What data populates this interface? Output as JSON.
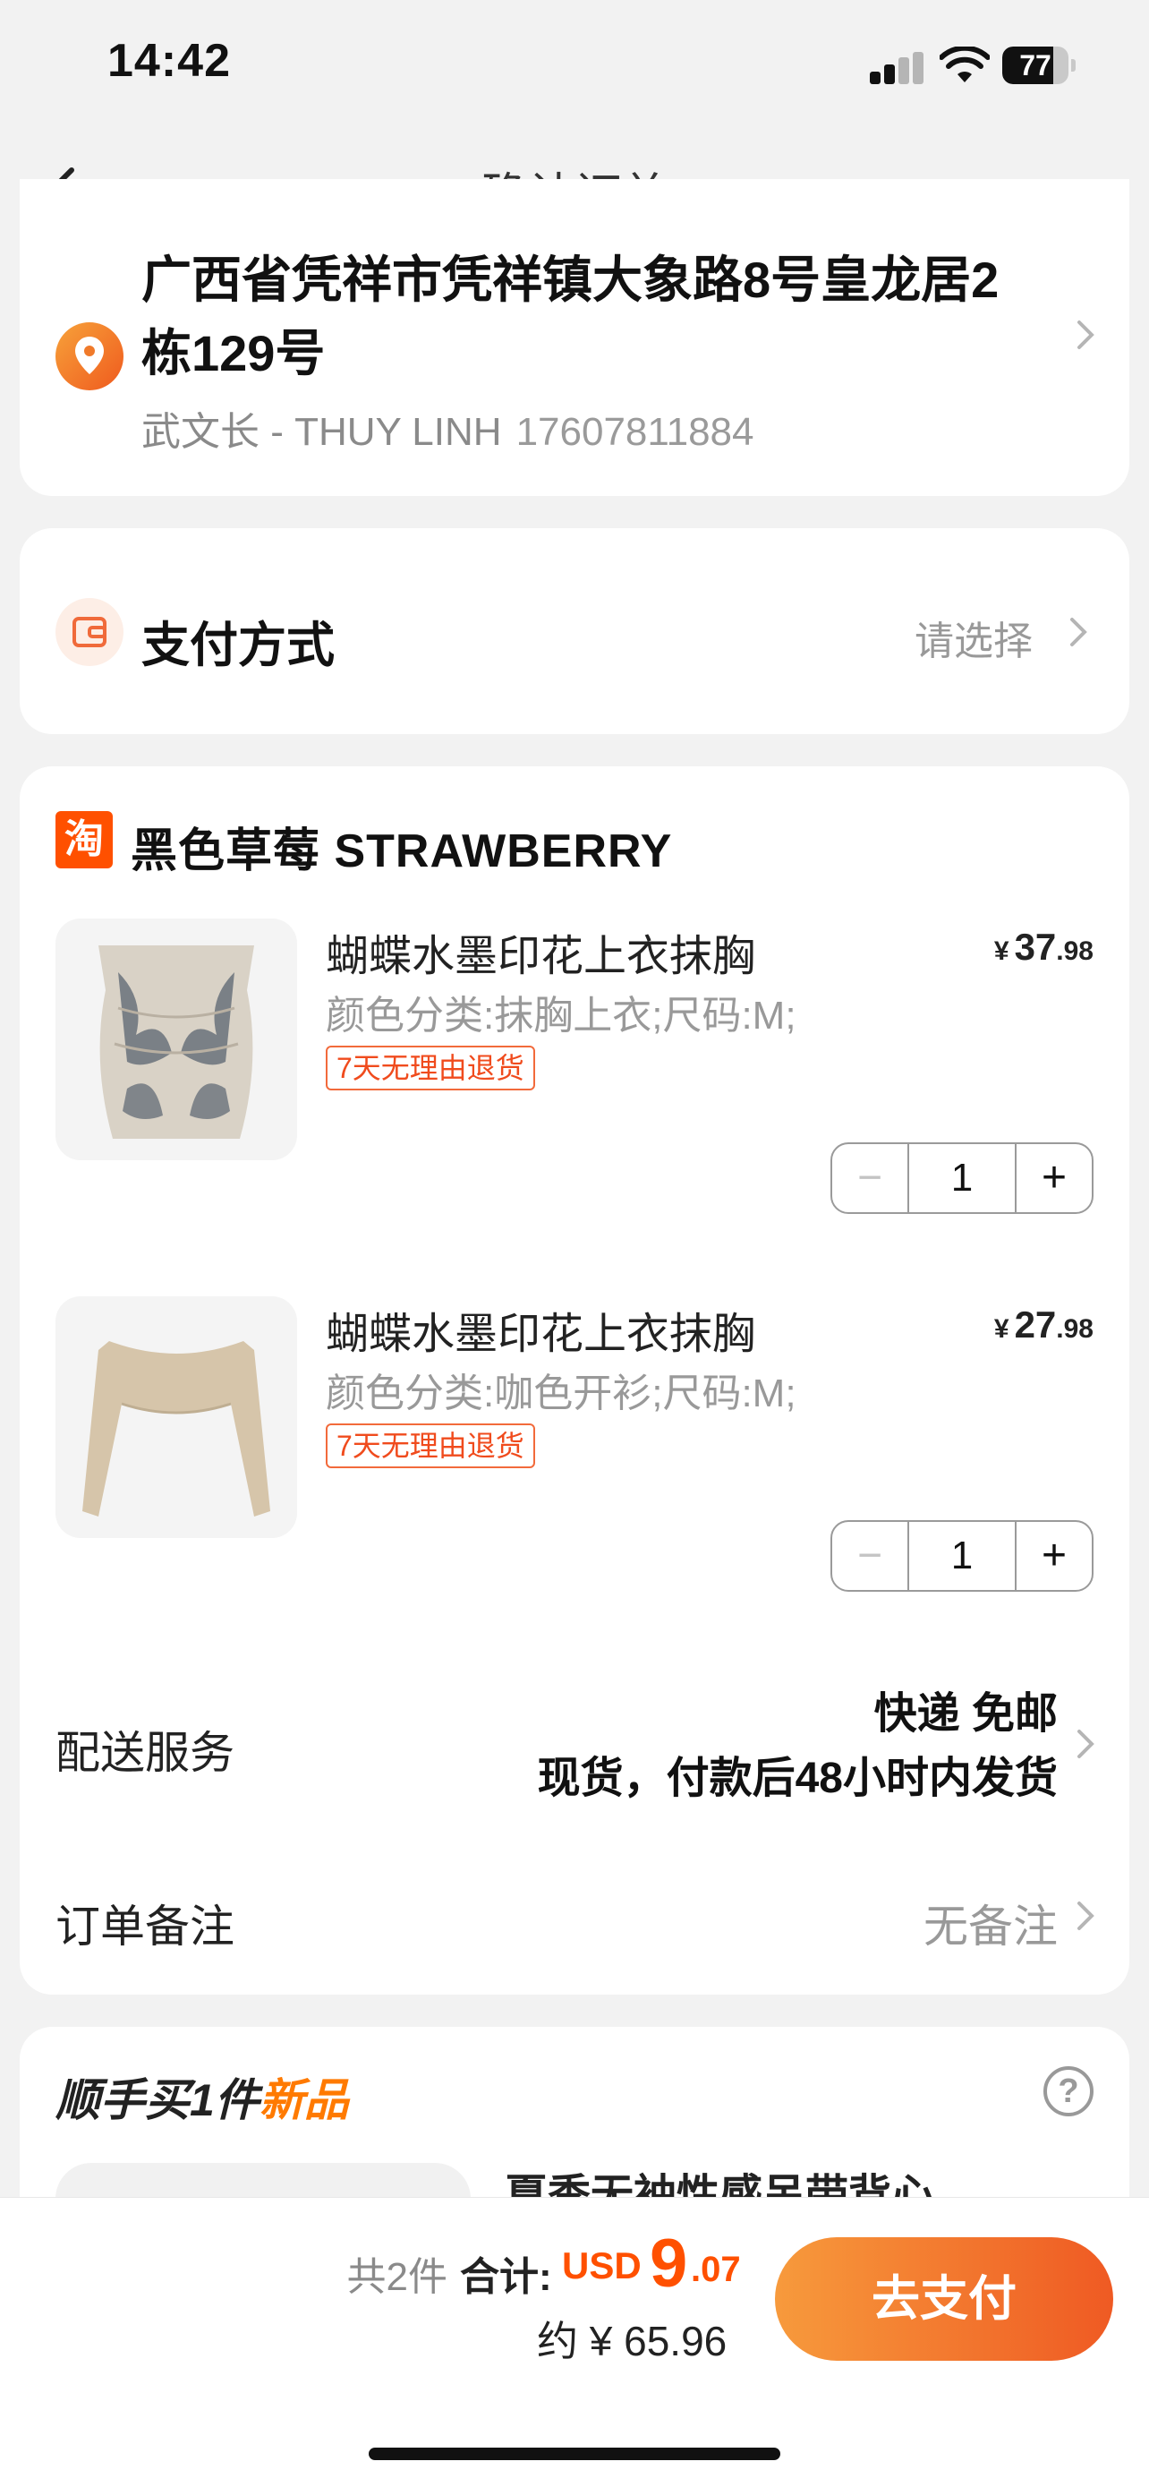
{
  "status_bar": {
    "time": "14:42",
    "battery": "77",
    "battery_level": 0.77
  },
  "header": {
    "title": "确认订单"
  },
  "address": {
    "text": "广西省凭祥市凭祥镇大象路8号皇龙居2栋129号",
    "name": "武文长 - THUY LINH",
    "phone": "17607811884"
  },
  "payment": {
    "label": "支付方式",
    "value": "请选择"
  },
  "shop": {
    "logo": "淘",
    "name": "黑色草莓 STRAWBERRY"
  },
  "items": [
    {
      "title": "蝴蝶水墨印花上衣抹胸",
      "spec": "颜色分类:抹胸上衣;尺码:M;",
      "tag": "7天无理由退货",
      "price_symbol": "¥",
      "price_int": "37",
      "price_dec": ".98",
      "qty": "1",
      "minus": "−",
      "plus": "+"
    },
    {
      "title": "蝴蝶水墨印花上衣抹胸",
      "spec": "颜色分类:咖色开衫;尺码:M;",
      "tag": "7天无理由退货",
      "price_symbol": "¥",
      "price_int": "27",
      "price_dec": ".98",
      "qty": "1",
      "minus": "−",
      "plus": "+"
    }
  ],
  "shipping": {
    "label": "配送服务",
    "line1": "快递 免邮",
    "line2": "现货，付款后48小时内发货"
  },
  "note": {
    "label": "订单备注",
    "value": "无备注"
  },
  "recommend": {
    "title_prefix": "顺手买1件",
    "title_highlight": "新品",
    "help": "?",
    "product_title": "夏季无袖性感吊带背心"
  },
  "footer": {
    "count": "共2件",
    "total_label": "合计:",
    "currency": "USD",
    "total_int": "9",
    "total_dec": ".07",
    "approx": "约 ¥ 65.96",
    "pay_button": "去支付"
  },
  "colors": {
    "accent": "#ff5000",
    "tag": "#f04b1d",
    "button_start": "#f79a3c",
    "button_end": "#ef5a23"
  }
}
